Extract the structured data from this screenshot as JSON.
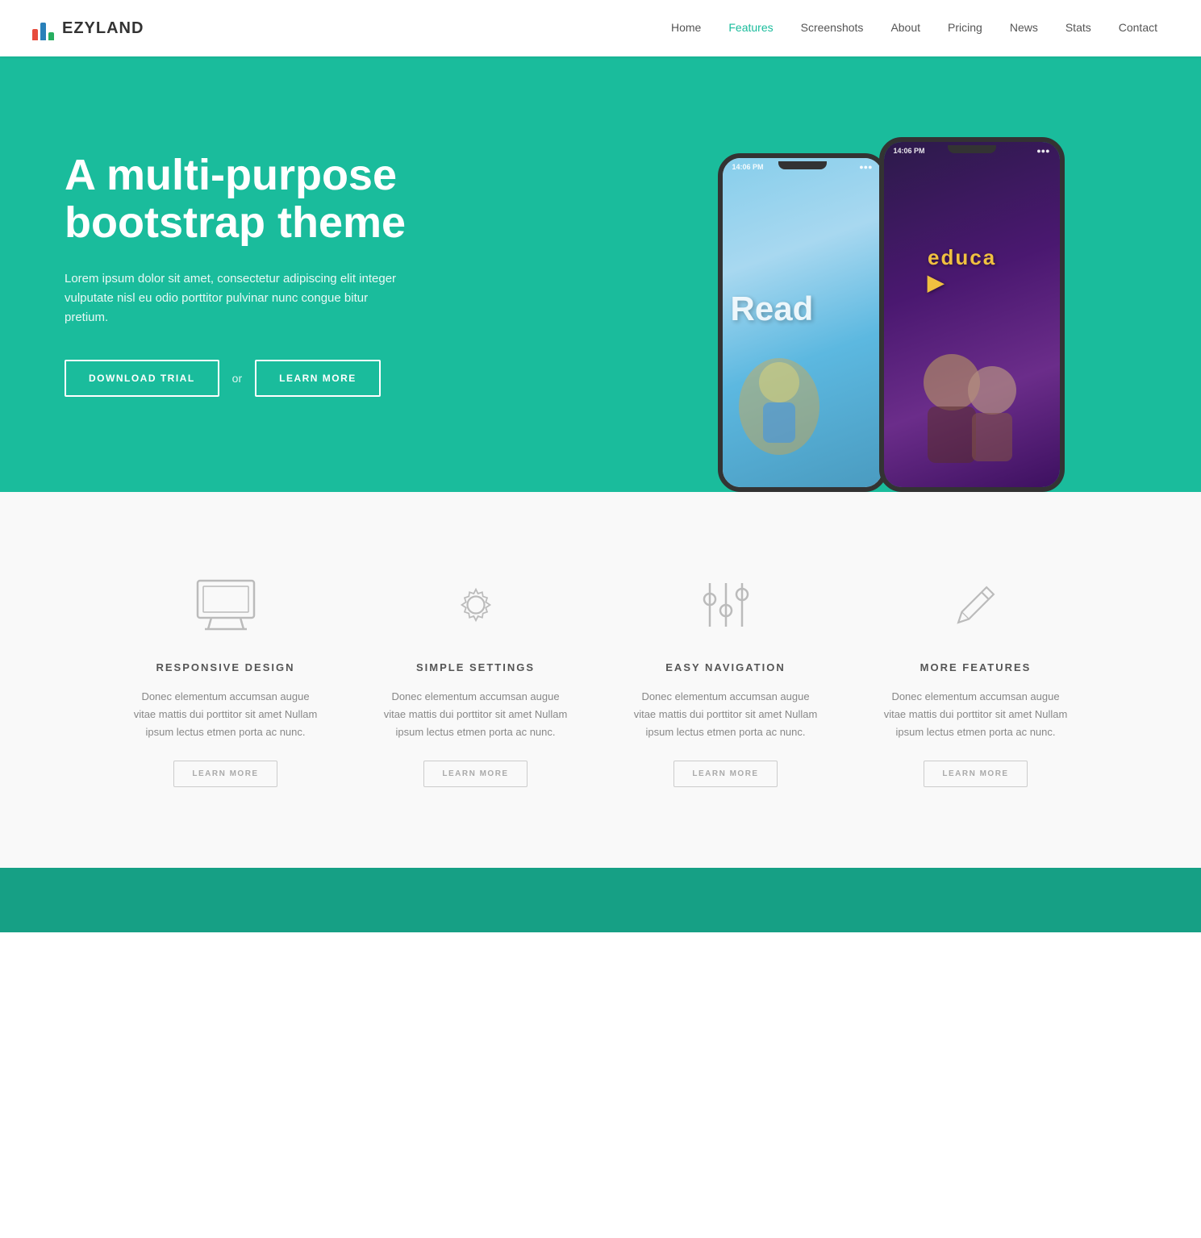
{
  "brand": {
    "name": "EZYLAND"
  },
  "nav": {
    "links": [
      {
        "label": "Home",
        "active": false
      },
      {
        "label": "Features",
        "active": true
      },
      {
        "label": "Screenshots",
        "active": false
      },
      {
        "label": "About",
        "active": false
      },
      {
        "label": "Pricing",
        "active": false
      },
      {
        "label": "News",
        "active": false
      },
      {
        "label": "Stats",
        "active": false
      },
      {
        "label": "Contact",
        "active": false
      }
    ]
  },
  "hero": {
    "title": "A multi-purpose bootstrap theme",
    "subtitle": "Lorem ipsum dolor sit amet, consectetur adipiscing elit integer vulputate nisl eu odio porttitor pulvinar nunc congue bitur pretium.",
    "btn_download": "DOWNLOAD TRIAL",
    "btn_or": "or",
    "btn_learn": "LEARN MORE"
  },
  "features": [
    {
      "icon": "monitor-icon",
      "title": "RESPONSIVE DESIGN",
      "desc": "Donec elementum accumsan augue vitae mattis dui porttitor sit amet Nullam ipsum lectus etmen porta ac nunc.",
      "btn": "LEARN MORE"
    },
    {
      "icon": "gear-icon",
      "title": "SIMPLE SETTINGS",
      "desc": "Donec elementum accumsan augue vitae mattis dui porttitor sit amet Nullam ipsum lectus etmen porta ac nunc.",
      "btn": "LEARN MORE"
    },
    {
      "icon": "sliders-icon",
      "title": "EASY NAVIGATION",
      "desc": "Donec elementum accumsan augue vitae mattis dui porttitor sit amet Nullam ipsum lectus etmen porta ac nunc.",
      "btn": "LEARN MORE"
    },
    {
      "icon": "pencil-icon",
      "title": "MORE FEATURES",
      "desc": "Donec elementum accumsan augue vitae mattis dui porttitor sit amet Nullam ipsum lectus etmen porta ac nunc.",
      "btn": "LEARN MORE"
    }
  ],
  "colors": {
    "primary": "#1abc9c",
    "dark": "#16a085",
    "text_dark": "#333",
    "text_muted": "#888"
  }
}
